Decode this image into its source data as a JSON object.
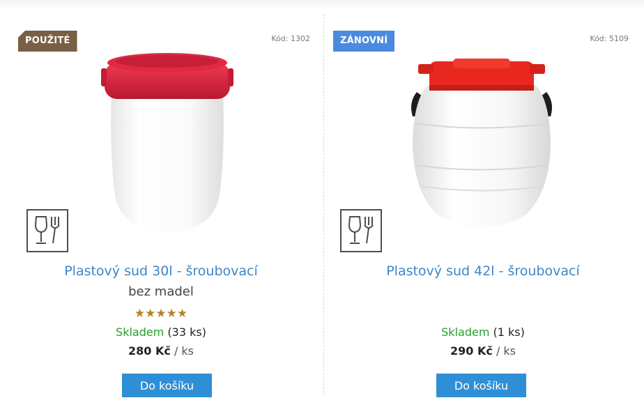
{
  "products": [
    {
      "badge": "POUŽITÉ",
      "code_label": "Kód:",
      "code_value": "1302",
      "name": "Plastový sud 30l - šroubovací",
      "subtitle": "bez madel",
      "rating_stars": "★★★★★",
      "rating": 5,
      "stock_status": "Skladem",
      "stock_count": "(33 ks)",
      "price": "280 Kč",
      "price_unit": "/ ks",
      "cart_label": "Do košíku",
      "food_safe_icon": "food-safe-icon",
      "badge_color": "#7a5f44",
      "lid_color": "#d8213a"
    },
    {
      "badge": "ZÁNOVNÍ",
      "code_label": "Kód:",
      "code_value": "5109",
      "name": "Plastový sud 42l - šroubovací",
      "subtitle": "",
      "stock_status": "Skladem",
      "stock_count": "(1 ks)",
      "price": "290 Kč",
      "price_unit": "/ ks",
      "cart_label": "Do košíku",
      "food_safe_icon": "food-safe-icon",
      "badge_color": "#4a8be0",
      "lid_color": "#e8281e"
    }
  ],
  "colors": {
    "link": "#3d86c9",
    "in_stock": "#2a9d2a",
    "button": "#2f8fd6",
    "star": "#b8802a"
  }
}
